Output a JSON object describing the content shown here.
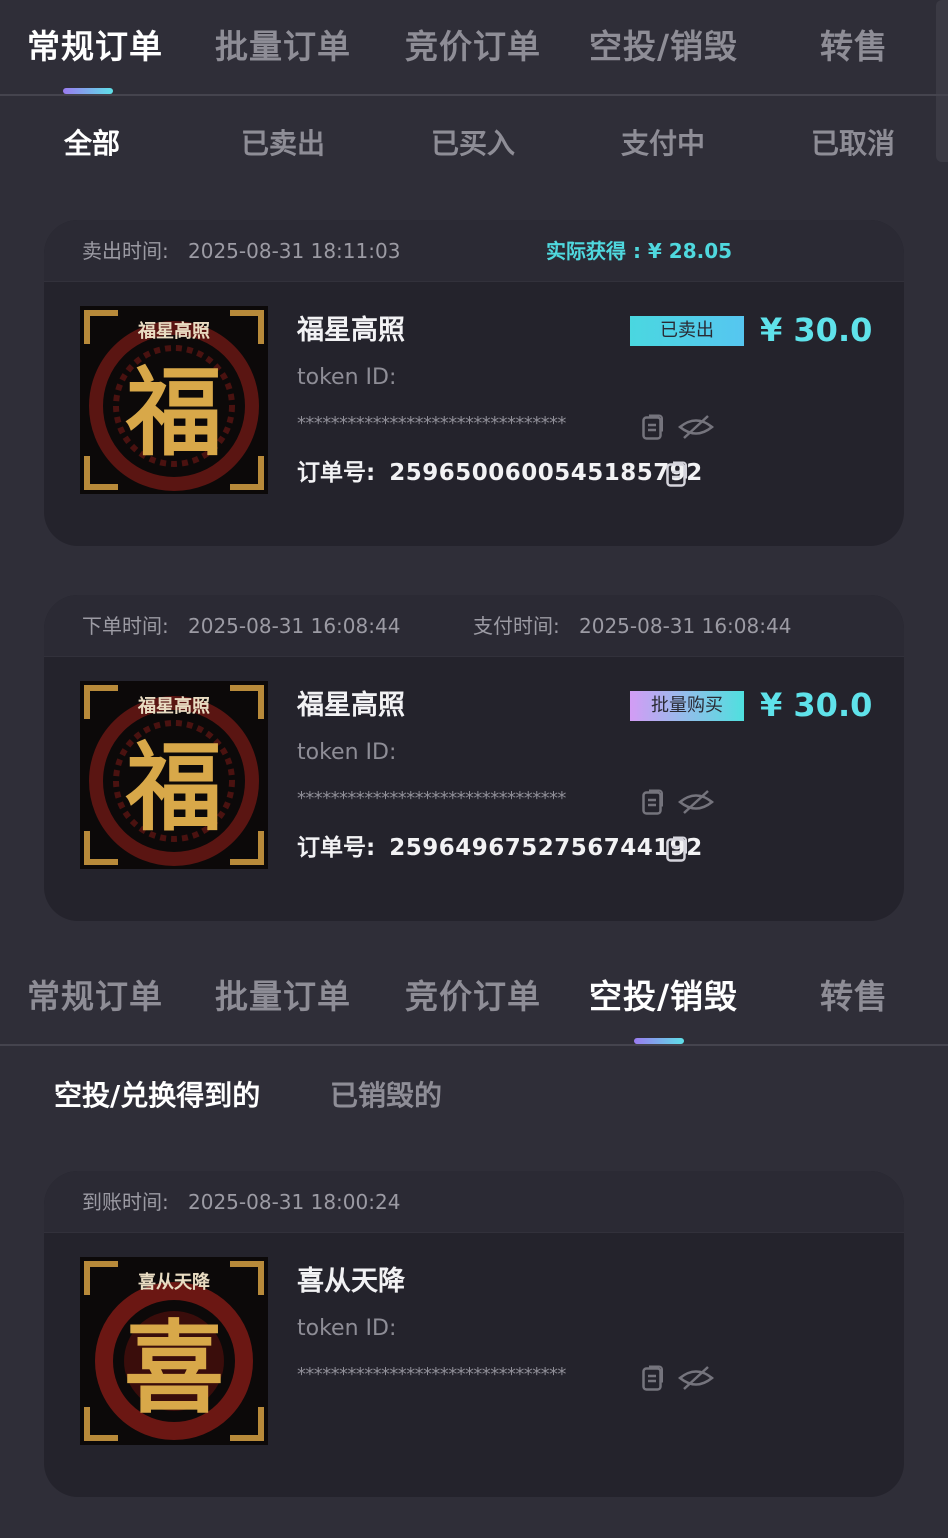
{
  "top_tabs": {
    "items": [
      "常规订单",
      "批量订单",
      "竞价订单",
      "空投/销毁",
      "转售"
    ],
    "active_index": 0
  },
  "sub_tabs": {
    "items": [
      "全部",
      "已卖出",
      "已买入",
      "支付中",
      "已取消"
    ],
    "active_index": 0
  },
  "orders": [
    {
      "header_label_1": "卖出时间:",
      "header_value_1": "2025-08-31 18:11:03",
      "earned": "实际获得 : ¥ 28.05",
      "thumb_text": "福星高照",
      "thumb_glyph": "福",
      "name": "福星高照",
      "token_label": "token ID:",
      "token_mask": "********************************",
      "badge": "已卖出",
      "price": "¥ 30.0",
      "order_label": "订单号:",
      "order_no": "2596500600545185792"
    },
    {
      "header_label_1": "下单时间:",
      "header_value_1": "2025-08-31 16:08:44",
      "header_label_2": "支付时间:",
      "header_value_2": "2025-08-31 16:08:44",
      "thumb_text": "福星高照",
      "thumb_glyph": "福",
      "name": "福星高照",
      "token_label": "token ID:",
      "token_mask": "********************************",
      "badge": "批量购买",
      "price": "¥ 30.0",
      "order_label": "订单号:",
      "order_no": "2596496752756744192"
    }
  ],
  "second_top_tabs": {
    "items": [
      "常规订单",
      "批量订单",
      "竞价订单",
      "空投/销毁",
      "转售"
    ],
    "active_index": 3
  },
  "airdrop_sub_tabs": {
    "items": [
      "空投/兑换得到的",
      "已销毁的"
    ],
    "active_index": 0
  },
  "airdrop_card": {
    "header_label": "到账时间:",
    "header_value": "2025-08-31 18:00:24",
    "thumb_text": "喜从天降",
    "thumb_glyph": "喜",
    "name": "喜从天降",
    "token_label": "token ID:",
    "token_mask": "********************************"
  },
  "icons": {
    "copy": "copy-icon",
    "hide": "eye-off-icon"
  },
  "colors": {
    "background": "#2f2e38",
    "card": "#24232c",
    "accent": "#5fe2ea",
    "tab_indicator_start": "#9a7bf0",
    "tab_indicator_end": "#5ee0e8"
  }
}
